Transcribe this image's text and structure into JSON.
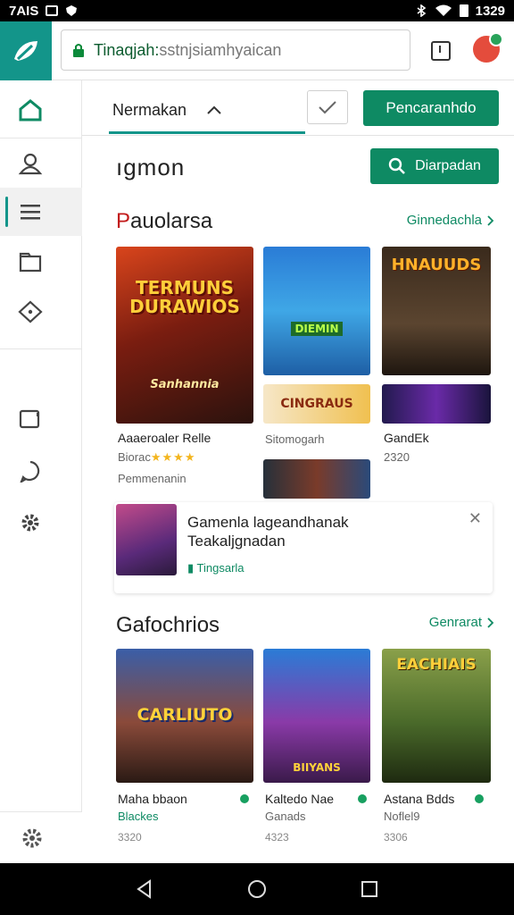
{
  "status": {
    "time_left": "7AIS",
    "time_right": "1329"
  },
  "browser": {
    "url_host": "Tinaqjah:",
    "url_path": "sstnjsiamhyaican"
  },
  "tabs": {
    "active_label": "Nermakan",
    "action_label": "Pencaranhdo"
  },
  "page": {
    "title": "ıgmon",
    "search_label": "Diarpadan"
  },
  "section1": {
    "title_first": "P",
    "title_rest": "auolarsa",
    "see_all": "Ginnedachla",
    "tiles": [
      {
        "art": "TERMUNS DURAWIOS",
        "art2": "Sanhannia",
        "name": "Aaaeroaler Relle",
        "meta": "Biorac",
        "extra": "Pemmenanin"
      },
      {
        "art": "DIEMIN",
        "name": "Sitomogarh",
        "meta": ""
      },
      {
        "art": "CINGRAUS",
        "name": "",
        "meta": ""
      },
      {
        "art": "HNAUUDS",
        "name": "GandEk",
        "meta": "2320"
      },
      {
        "art": "",
        "name": "",
        "meta": ""
      },
      {
        "art": "",
        "name": "",
        "meta": ""
      }
    ],
    "stars": "★★★★"
  },
  "promo": {
    "title_line1": "Gamenla lageandhanak",
    "title_line2": "Teakaljgnadan",
    "tag": "Tingsarla"
  },
  "section2": {
    "title": "Gafochrios",
    "see_all": "Genrarat",
    "tiles": [
      {
        "art": "CARLIUTO",
        "name": "Maha bbaon",
        "meta": "Blackes",
        "num": "3320"
      },
      {
        "art": "BIIYANS",
        "name": "Kaltedo Nae",
        "meta": "Ganads",
        "num": "4323"
      },
      {
        "art": "EACHIAIS",
        "name": "Astana Bdds",
        "meta": "Noflel9",
        "num": "3306"
      }
    ]
  },
  "colors": {
    "brand": "#13958a",
    "action": "#0e8a63",
    "accent_red": "#c21a1a"
  }
}
